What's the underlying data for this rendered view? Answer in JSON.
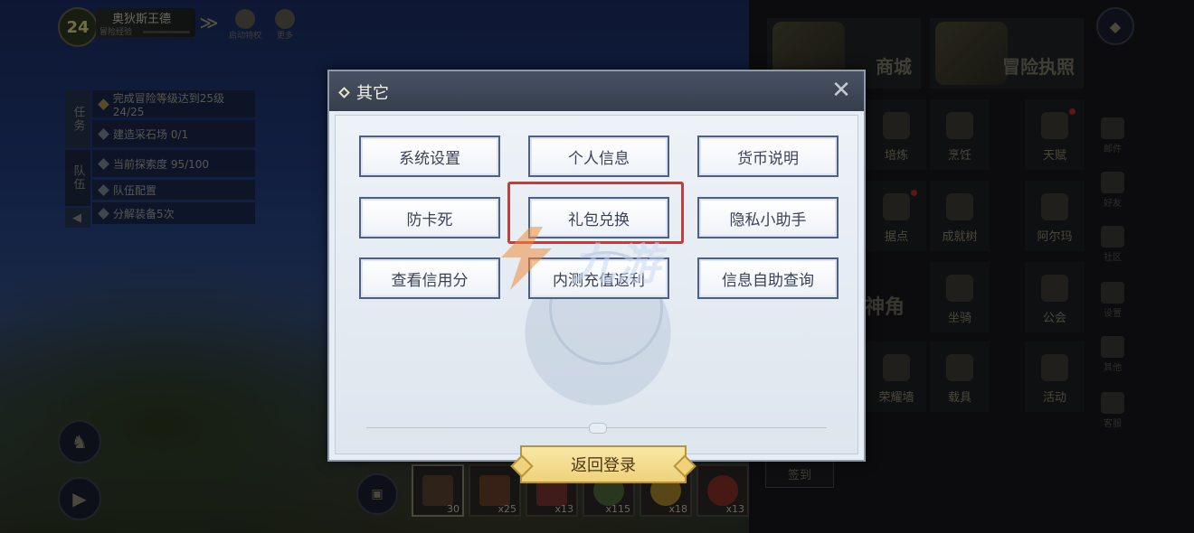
{
  "hud": {
    "level": "24",
    "player_name": "奥狄斯王德",
    "subtitle": "冒险经验",
    "buttons": [
      "启动特权",
      "更多"
    ]
  },
  "quest_tracker": {
    "tabs": [
      "任务",
      "队伍"
    ],
    "items": [
      "完成冒险等级达到25级 24/25",
      "建造采石场 0/1",
      "当前探索度 95/100",
      "队伍配置",
      "分解装备5次"
    ]
  },
  "inventory": {
    "slots": [
      {
        "tag": "",
        "count": "30"
      },
      {
        "tag": "",
        "count": "x25"
      },
      {
        "tag": "T1",
        "count": "x13"
      },
      {
        "tag": "T1",
        "count": "x115"
      },
      {
        "tag": "",
        "count": "x18"
      },
      {
        "tag": "",
        "count": "x13"
      }
    ]
  },
  "right_menu": {
    "big_tiles": [
      "商城",
      "冒险执照"
    ],
    "tiles": [
      "培炼",
      "烹饪",
      "天赋",
      "据点",
      "成就树",
      "阿尔玛",
      "神角",
      "坐骑",
      "公会",
      "荣耀墙",
      "载具",
      "活动"
    ],
    "side_nav": [
      "邮件",
      "好友",
      "社区",
      "设置",
      "其他",
      "客服"
    ],
    "signin": "签到"
  },
  "dialog": {
    "title": "其它",
    "options": [
      "系统设置",
      "个人信息",
      "货币说明",
      "防卡死",
      "礼包兑换",
      "隐私小助手",
      "查看信用分",
      "内测充值返利",
      "信息自助查询"
    ],
    "return_button": "返回登录"
  },
  "watermark": {
    "text": "九游"
  },
  "colors": {
    "highlight": "#e3302a",
    "button_border": "#4f5f82",
    "return_button": "#efd27a"
  }
}
